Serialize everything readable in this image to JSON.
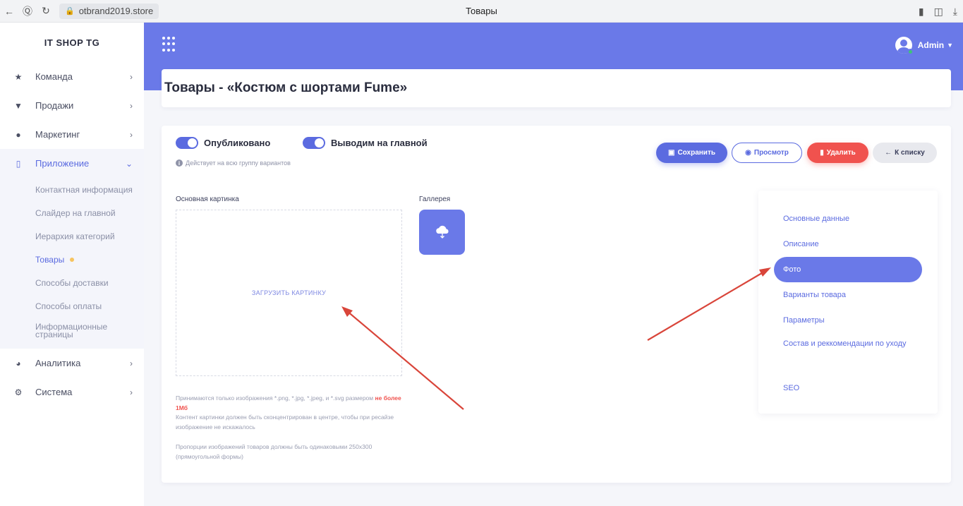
{
  "browser": {
    "url": "otbrand2019.store",
    "tab_title": "Товары"
  },
  "sidebar": {
    "brand": "IT SHOP TG",
    "items": [
      {
        "label": "Команда",
        "icon": "team-icon"
      },
      {
        "label": "Продажи",
        "icon": "cart-icon"
      },
      {
        "label": "Маркетинг",
        "icon": "marketing-icon"
      },
      {
        "label": "Приложение",
        "icon": "phone-icon"
      },
      {
        "label": "Аналитика",
        "icon": "pie-chart-icon"
      },
      {
        "label": "Система",
        "icon": "gears-icon"
      }
    ],
    "submenu": [
      "Контактная информация",
      "Слайдер на главной",
      "Иерархия категорий",
      "Товары",
      "Способы доставки",
      "Способы оплаты",
      "Информационные страницы"
    ]
  },
  "header": {
    "user": "Admin",
    "accent": "#6a79e8"
  },
  "page": {
    "title": "Товары - «Костюм с шортами Fume»"
  },
  "toggles": {
    "published": "Опубликовано",
    "featured": "Выводим на главной",
    "hint": "Действует на всю группу вариантов"
  },
  "buttons": {
    "save": "Сохранить",
    "view": "Просмотр",
    "delete": "Удалить",
    "back": "К списку"
  },
  "images": {
    "main_label": "Основная картинка",
    "upload": "ЗАГРУЗИТЬ КАРТИНКУ",
    "note_prefix": "Принимаются только изображения *.png, *.jpg, *.jpeg, и *.svg размером",
    "note_limit": "не более 1Мб",
    "note_center": "Контент картинки должен быть сконцентрирован в центре, чтобы при ресайзе изображение не искажалось",
    "note_ratio": "Пропорции изображений товаров должны быть одинаковыми 250х300 (прямоугольной формы)",
    "gallery_label": "Галлерея"
  },
  "nav": [
    "Основные данные",
    "Описание",
    "Фото",
    "Варианты товара",
    "Параметры",
    "Состав и реккомендации по уходу",
    "SEO"
  ],
  "colors": {
    "primary": "#5b6be0",
    "danger": "#f0524e",
    "annotation_arrow": "#d9453a"
  }
}
